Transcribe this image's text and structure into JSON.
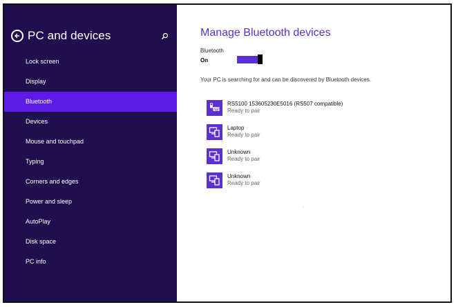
{
  "sidebar": {
    "title": "PC and devices",
    "back_icon": "back-arrow-icon",
    "search_icon": "search-icon",
    "items": [
      {
        "label": "Lock screen"
      },
      {
        "label": "Display"
      },
      {
        "label": "Bluetooth",
        "active": true
      },
      {
        "label": "Devices"
      },
      {
        "label": "Mouse and touchpad"
      },
      {
        "label": "Typing"
      },
      {
        "label": "Corners and edges"
      },
      {
        "label": "Power and sleep"
      },
      {
        "label": "AutoPlay"
      },
      {
        "label": "Disk space"
      },
      {
        "label": "PC info"
      }
    ]
  },
  "main": {
    "title": "Manage Bluetooth devices",
    "bluetooth_label": "Bluetooth",
    "bluetooth_state": "On",
    "search_message": "Your PC is searching for and can be discovered by Bluetooth devices.",
    "devices": [
      {
        "name": "RS5100  153605230E5016  (RS507 compatible)",
        "status": "Ready to pair",
        "icon": "scanner-device-icon"
      },
      {
        "name": "Laptop",
        "status": "Ready to pair",
        "icon": "computer-device-icon"
      },
      {
        "name": "Unknown",
        "status": "Ready to pair",
        "icon": "computer-device-icon"
      },
      {
        "name": "Unknown",
        "status": "Ready to pair",
        "icon": "computer-device-icon"
      }
    ]
  },
  "colors": {
    "sidebar_bg": "#1f0f4f",
    "accent": "#5c2fd0",
    "active_item": "#5b1ce6"
  }
}
